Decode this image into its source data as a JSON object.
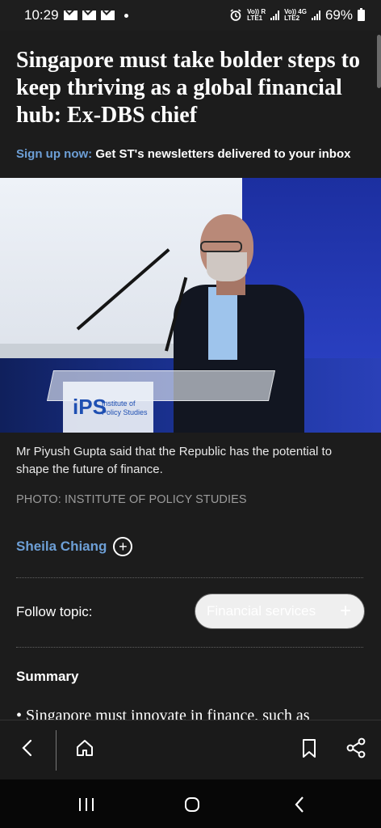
{
  "status_bar": {
    "time": "10:29",
    "signal_label_1": "Vo)) R",
    "signal_sub_1": "LTE1",
    "signal_label_2": "Vo)) 4G",
    "signal_sub_2": "LTE2",
    "battery": "69%",
    "icons": [
      "gmail-icon",
      "gmail-icon",
      "gmail-icon",
      "notification-dot",
      "alarm-icon",
      "signal-icon",
      "battery-icon"
    ]
  },
  "article": {
    "headline": "Singapore must take bolder steps to keep thriving as a global financial hub: Ex-DBS chief",
    "signup_lead": "Sign up now:",
    "signup_text": " Get ST's newsletters delivered to your inbox",
    "image": {
      "podium_logo": "iPS",
      "podium_text": "Institute of Policy Studies"
    },
    "caption": "Mr Piyush Gupta said that the Republic has the potential to shape the future of finance.",
    "credit": "PHOTO: INSTITUTE OF POLICY STUDIES",
    "author": "Sheila Chiang",
    "follow_label": "Follow topic:",
    "topic": "Financial services",
    "summary_title": "Summary",
    "summary_first": "• Singapore must innovate in finance, such as"
  },
  "toolbar": {
    "icons": [
      "back-icon",
      "home-icon",
      "bookmark-icon",
      "share-icon"
    ]
  },
  "colors": {
    "background": "#1c1c1c",
    "link": "#6d9fd6",
    "caption": "#e8e8e8",
    "credit": "#9b9b9b",
    "toolbar": "#1a1a1a"
  }
}
